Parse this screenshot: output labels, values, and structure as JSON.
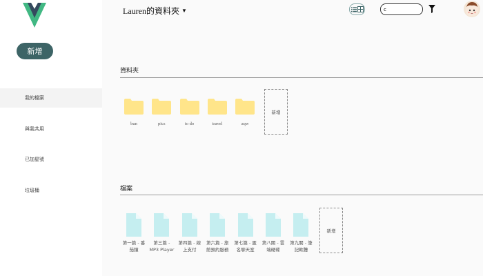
{
  "brand": {
    "logo_icon": "vue-logo-icon",
    "colors": {
      "outer": "#41b883",
      "inner": "#35495e"
    }
  },
  "sidebar": {
    "new_button": "新增",
    "items": [
      {
        "label": "我的檔案",
        "active": true
      },
      {
        "label": "與我共用",
        "active": false
      },
      {
        "label": "已加星號",
        "active": false
      },
      {
        "label": "垃圾桶",
        "active": false
      }
    ]
  },
  "header": {
    "title": "Lauren的資料夾",
    "caret_icon": "caret-down-icon",
    "search_placeholder": "",
    "search_value": "c",
    "filter_icon": "filter-icon",
    "avatar_icon": "user-avatar"
  },
  "folders": {
    "title": "資料夾",
    "items": [
      "bun",
      "pics",
      "to do",
      "travel",
      "aqw"
    ],
    "add_label": "新增",
    "color": "#ffe58a"
  },
  "files": {
    "title": "檔案",
    "items": [
      "第一篇 - 番茄鐘",
      "第三篇 - MP3 Player",
      "第四篇 - 線上支付",
      "第六篇 - 旅館預約服務",
      "第七篇 - 匿名聊天室",
      "第八關 - 雲端硬碟",
      "第九關 - 筆記軟體"
    ],
    "add_label": "新增",
    "color": "#c5eef0"
  },
  "accent": "#3d6466"
}
